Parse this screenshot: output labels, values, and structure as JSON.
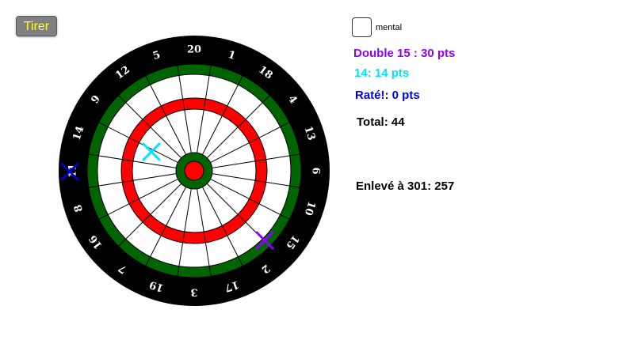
{
  "toolbar": {
    "tirer_label": "Tirer"
  },
  "mental": {
    "label": "mental",
    "checked": false
  },
  "results": {
    "throw1": {
      "text": "Double 15 : 30 pts",
      "color": "#8f00ff"
    },
    "throw2": {
      "text": "14: 14 pts",
      "color": "#00e5ff"
    },
    "throw3": {
      "text": "Raté!: 0 pts",
      "color": "#0000e6"
    },
    "total": "Total: 44",
    "remaining": "Enlevé à 301: 257"
  },
  "board": {
    "numbers": [
      "20",
      "1",
      "18",
      "4",
      "13",
      "6",
      "10",
      "15",
      "2",
      "17",
      "3",
      "19",
      "7",
      "16",
      "8",
      "11",
      "14",
      "9",
      "12",
      "5"
    ],
    "colors": {
      "outer": "#000000",
      "double_ring": "#006400",
      "triple_ring": "#ff0000",
      "bull_outer": "#006400",
      "bull_inner": "#ff0000",
      "single": "#ffffff"
    }
  },
  "darts": [
    {
      "name": "dart-miss-marker",
      "color": "#0000cc"
    },
    {
      "name": "dart-14-marker",
      "color": "#00e5ff"
    },
    {
      "name": "dart-double-15-marker",
      "color": "#8f00ff"
    }
  ]
}
